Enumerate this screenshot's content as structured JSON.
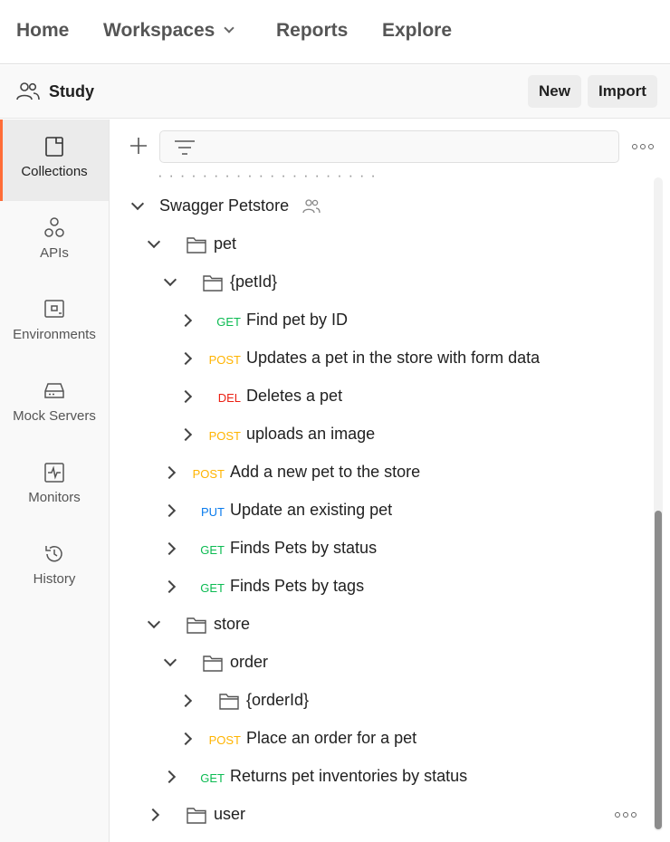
{
  "topnav": {
    "items": [
      {
        "label": "Home"
      },
      {
        "label": "Workspaces"
      },
      {
        "label": "Reports"
      },
      {
        "label": "Explore"
      }
    ]
  },
  "workspace": {
    "name": "Study",
    "new_label": "New",
    "import_label": "Import"
  },
  "sidebar": {
    "items": [
      {
        "label": "Collections",
        "icon": "collections-icon",
        "active": true
      },
      {
        "label": "APIs",
        "icon": "apis-icon"
      },
      {
        "label": "Environments",
        "icon": "environments-icon"
      },
      {
        "label": "Mock Servers",
        "icon": "mock-servers-icon"
      },
      {
        "label": "Monitors",
        "icon": "monitors-icon"
      },
      {
        "label": "History",
        "icon": "history-icon"
      }
    ]
  },
  "tree": {
    "collection": "Swagger Petstore",
    "rows": [
      {
        "type": "folder",
        "label": "pet",
        "expanded": true
      },
      {
        "type": "folder",
        "label": "{petId}",
        "expanded": true
      },
      {
        "type": "request",
        "method": "GET",
        "label": "Find pet by ID"
      },
      {
        "type": "request",
        "method": "POST",
        "label": "Updates a pet in the store with form data"
      },
      {
        "type": "request",
        "method": "DEL",
        "label": "Deletes a pet"
      },
      {
        "type": "request",
        "method": "POST",
        "label": "uploads an image"
      },
      {
        "type": "request",
        "method": "POST",
        "label": "Add a new pet to the store"
      },
      {
        "type": "request",
        "method": "PUT",
        "label": "Update an existing pet"
      },
      {
        "type": "request",
        "method": "GET",
        "label": "Finds Pets by status"
      },
      {
        "type": "request",
        "method": "GET",
        "label": "Finds Pets by tags"
      },
      {
        "type": "folder",
        "label": "store",
        "expanded": true
      },
      {
        "type": "folder",
        "label": "order",
        "expanded": true
      },
      {
        "type": "folder",
        "label": "{orderId}",
        "expanded": false
      },
      {
        "type": "request",
        "method": "POST",
        "label": "Place an order for a pet"
      },
      {
        "type": "request",
        "method": "GET",
        "label": "Returns pet inventories by status"
      },
      {
        "type": "folder",
        "label": "user",
        "expanded": false
      }
    ]
  },
  "colors": {
    "accent": "#ff6c37",
    "get": "#0cbb52",
    "post": "#ffb400",
    "delete": "#eb2013",
    "put": "#097bed"
  }
}
